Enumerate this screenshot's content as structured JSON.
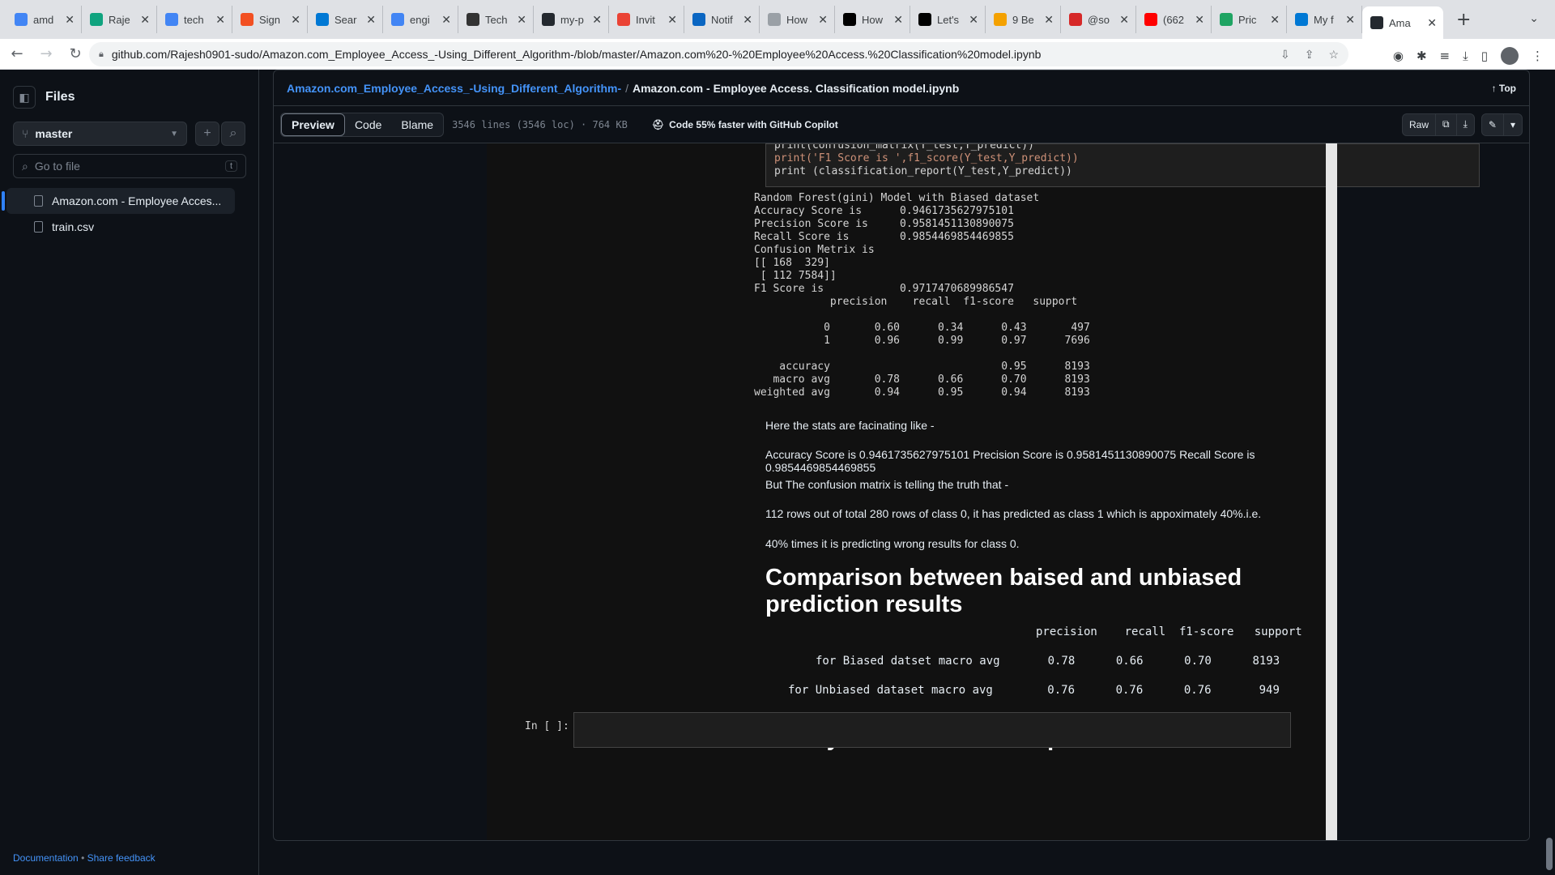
{
  "browser": {
    "tabs": [
      {
        "label": "amd",
        "icon": "google-icon",
        "color": "#4285f4"
      },
      {
        "label": "Raje",
        "icon": "chatgpt-icon",
        "color": "#10a37f"
      },
      {
        "label": "tech",
        "icon": "google-icon",
        "color": "#4285f4"
      },
      {
        "label": "Sign",
        "icon": "microsoft-icon",
        "color": "#f25022"
      },
      {
        "label": "Sear",
        "icon": "onedrive-icon",
        "color": "#0078d4"
      },
      {
        "label": "engi",
        "icon": "google-icon",
        "color": "#4285f4"
      },
      {
        "label": "Tech",
        "icon": "github-avatar-icon",
        "color": "#333"
      },
      {
        "label": "my-p",
        "icon": "github-icon",
        "color": "#24292f"
      },
      {
        "label": "Invit",
        "icon": "gmail-icon",
        "color": "#ea4335"
      },
      {
        "label": "Notif",
        "icon": "linkedin-icon",
        "color": "#0a66c2"
      },
      {
        "label": "How",
        "icon": "page-icon",
        "color": "#9aa0a6"
      },
      {
        "label": "How",
        "icon": "notion-icon",
        "color": "#000"
      },
      {
        "label": "Let's",
        "icon": "medium-icon",
        "color": "#000"
      },
      {
        "label": "9 Be",
        "icon": "page-orange-icon",
        "color": "#f4a100"
      },
      {
        "label": "@so",
        "icon": "red-app-icon",
        "color": "#d62828"
      },
      {
        "label": "(662",
        "icon": "youtube-icon",
        "color": "#ff0000"
      },
      {
        "label": "Pric",
        "icon": "drive-icon",
        "color": "#1fa463"
      },
      {
        "label": "My f",
        "icon": "onedrive-icon",
        "color": "#0078d4"
      },
      {
        "label": "Ama",
        "icon": "github-icon",
        "color": "#24292f",
        "active": true
      }
    ],
    "url": "github.com/Rajesh0901-sudo/Amazon.com_Employee_Access_-Using_Different_Algorithm-/blob/master/Amazon.com%20-%20Employee%20Access.%20Classification%20model.ipynb"
  },
  "sidebar": {
    "title": "Files",
    "branch": "master",
    "search_placeholder": "Go to file",
    "search_shortcut": "t",
    "files": [
      {
        "label": "Amazon.com - Employee Acces...",
        "selected": true
      },
      {
        "label": "train.csv",
        "selected": false
      }
    ],
    "footer_docs": "Documentation",
    "footer_sep": "•",
    "footer_feedback": "Share feedback"
  },
  "header": {
    "repo": "Amazon.com_Employee_Access_-Using_Different_Algorithm-",
    "sep": "/",
    "file": "Amazon.com - Employee Access. Classification model.ipynb",
    "top": "↑ Top"
  },
  "viewbar": {
    "tabs": [
      "Preview",
      "Code",
      "Blame"
    ],
    "meta": "3546 lines (3546 loc) · 764 KB",
    "copilot": "Code 55% faster with GitHub Copilot",
    "raw": "Raw"
  },
  "notebook": {
    "code_lines": [
      "print(confusion_matrix(Y_test,Y_predict))",
      "print('F1 Score is            ',f1_score(Y_test,Y_predict))",
      "print (classification_report(Y_test,Y_predict))"
    ],
    "output": "Random Forest(gini) Model with Biased dataset\nAccuracy Score is      0.9461735627975101\nPrecision Score is     0.9581451130890075\nRecall Score is        0.9854469854469855\nConfusion Metrix is\n[[ 168  329]\n [ 112 7584]]\nF1 Score is            0.9717470689986547\n            precision    recall  f1-score   support\n\n           0       0.60      0.34      0.43       497\n           1       0.96      0.99      0.97      7696\n\n    accuracy                           0.95      8193\n   macro avg       0.78      0.66      0.70      8193\nweighted avg       0.94      0.95      0.94      8193",
    "md1": "Here the stats are facinating like -",
    "md2": "Accuracy Score is 0.9461735627975101 Precision Score is 0.9581451130890075 Recall Score is 0.9854469854469855",
    "md3": "But The confusion matrix is telling the truth that -",
    "md4": "112 rows out of total 280 rows of class 0, it has predicted as class 1 which is appoximately 40%.i.e.",
    "md5": "40% times it is predicting wrong results for class 0.",
    "heading1": "Comparison between baised and unbiased prediction results",
    "comparison": {
      "headers": "precision    recall  f1-score   support",
      "row1": "for Biased datset macro avg       0.78      0.66      0.70      8193",
      "row2": "for Unbiased dataset macro avg        0.76      0.76      0.76       949"
    },
    "heading2": "clearly Unbiased dataset performs better",
    "prompt": "In [ ]:"
  }
}
